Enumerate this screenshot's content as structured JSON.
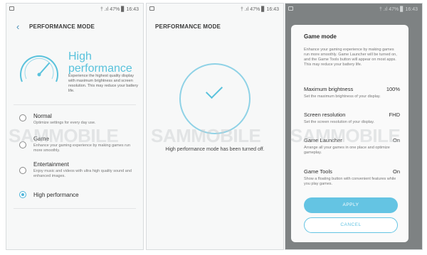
{
  "status": {
    "panel1": "† .ıl 47% ▊ 16:43",
    "panel2": "† .ıl 47% ▊ 16:43",
    "panel3": "† .ıl 47% ▊ 16:43"
  },
  "panel1": {
    "title": "PERFORMANCE MODE",
    "header": {
      "title": "High\nperformance",
      "description": "Experience the highest quality display with maximum brightness and screen resolution. This may reduce your battery life."
    },
    "modes": [
      {
        "name": "Normal",
        "description": "Optimize settings for every day use.",
        "checked": false
      },
      {
        "name": "Game",
        "description": "Enhance your gaming experience by making games run more smoothly.",
        "checked": false
      },
      {
        "name": "Entertainment",
        "description": "Enjoy music and videos with ultra high quality sound and enhanced images.",
        "checked": false
      },
      {
        "name": "High performance",
        "description": "",
        "checked": true
      }
    ]
  },
  "panel2": {
    "title": "PERFORMANCE MODE",
    "message": "High performance mode has been turned off."
  },
  "panel3": {
    "dialog": {
      "title": "Game mode",
      "intro": "Enhance your gaming experience by making games run more smoothly. Game Launcher will be turned on, and the Game Tools button will appear on most apps. This may reduce your battery life.",
      "settings": [
        {
          "label": "Maximum brightness",
          "value": "100%",
          "description": "Set the maximum brightness of your display."
        },
        {
          "label": "Screen resolution",
          "value": "FHD",
          "description": "Set the screen resolution of your display."
        },
        {
          "label": "Game Launcher",
          "value": "On",
          "description": "Arrange all your games in one place and optimize gameplay."
        },
        {
          "label": "Game Tools",
          "value": "On",
          "description": "Show a floating button with convenient features while you play games."
        }
      ],
      "apply_label": "APPLY",
      "cancel_label": "CANCEL"
    }
  },
  "watermark": [
    "SAMMOBILE",
    "SAMMOBILE",
    "SAMMOBILE"
  ],
  "colors": {
    "accent": "#59c2dc",
    "button": "#64c4e3",
    "dim_overlay": "#7e8283"
  }
}
